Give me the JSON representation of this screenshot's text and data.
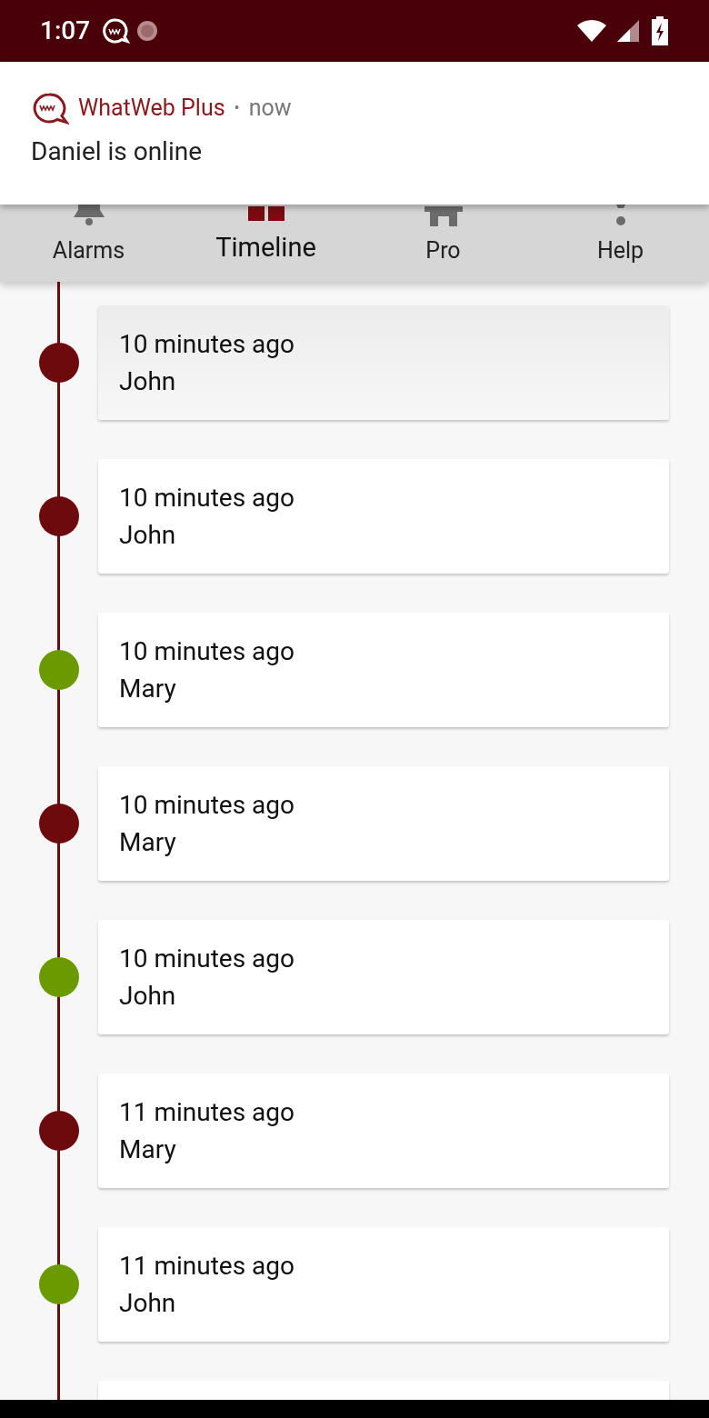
{
  "status_bar": {
    "time": "1:07"
  },
  "notification": {
    "app_name": "WhatWeb Plus",
    "separator": "•",
    "time": "now",
    "message": "Daniel is online"
  },
  "tabs": [
    {
      "label": "Alarms",
      "selected": false
    },
    {
      "label": "Timeline",
      "selected": true
    },
    {
      "label": "Pro",
      "selected": false
    },
    {
      "label": "Help",
      "selected": false
    }
  ],
  "timeline": [
    {
      "time": "10 minutes ago",
      "name": "John",
      "color": "#6d0a0e"
    },
    {
      "time": "10 minutes ago",
      "name": "John",
      "color": "#6d0a0e"
    },
    {
      "time": "10 minutes ago",
      "name": "Mary",
      "color": "#6a9a00"
    },
    {
      "time": "10 minutes ago",
      "name": "Mary",
      "color": "#6d0a0e"
    },
    {
      "time": "10 minutes ago",
      "name": "John",
      "color": "#6a9a00"
    },
    {
      "time": "11 minutes ago",
      "name": "Mary",
      "color": "#6d0a0e"
    },
    {
      "time": "11 minutes ago",
      "name": "John",
      "color": "#6a9a00"
    }
  ]
}
